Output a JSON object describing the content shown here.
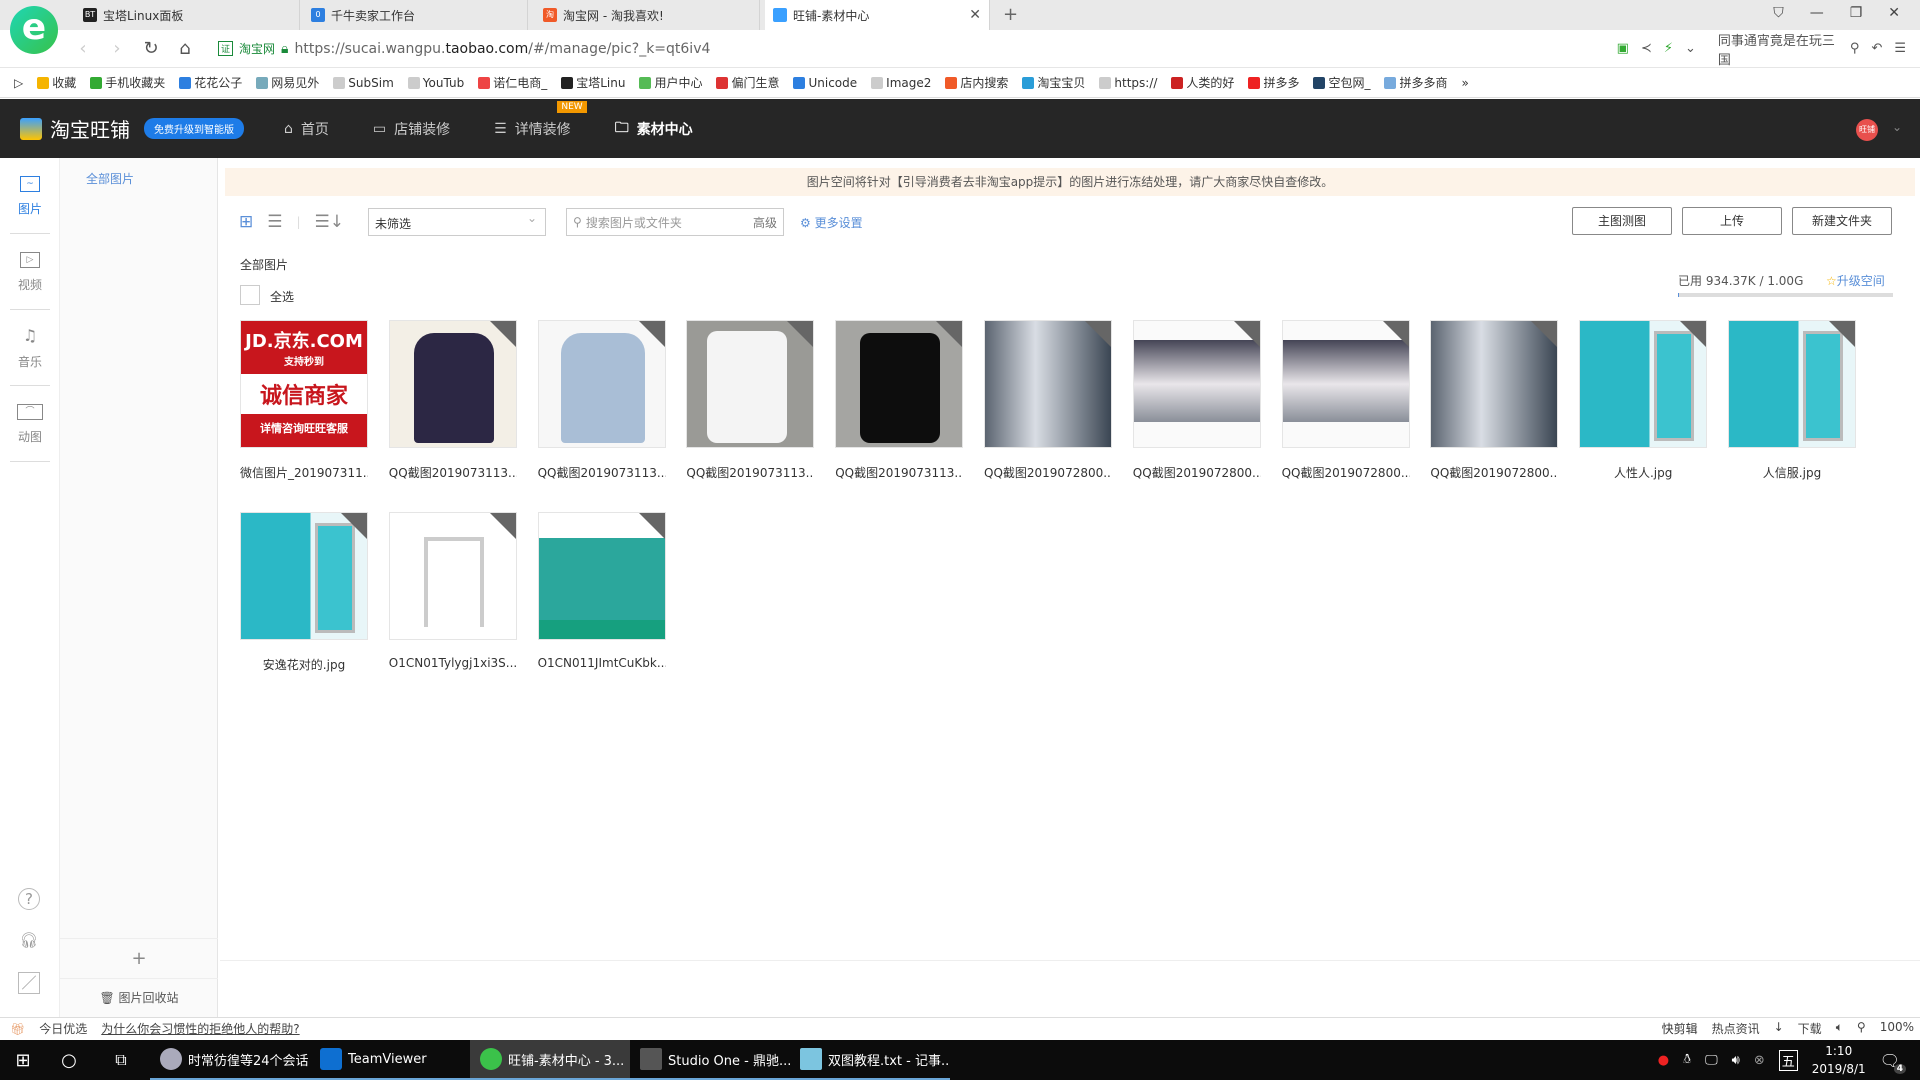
{
  "browser": {
    "tabs": [
      {
        "label": "宝塔Linux面板",
        "icon": "BT"
      },
      {
        "label": "千牛卖家工作台",
        "icon": "qianniu"
      },
      {
        "label": "淘宝网 - 淘我喜欢!",
        "icon": "taobao"
      },
      {
        "label": "旺铺-素材中心",
        "icon": "wangpu",
        "active": true
      }
    ],
    "url_prefix": "https://sucai.wangpu.",
    "url_domain": "taobao.com",
    "url_suffix": "/#/manage/pic?_k=qt6iv4",
    "cert_label": "淘宝网",
    "search_hint": "同事通宵竟是在玩三国",
    "bookmarks": [
      "收藏",
      "手机收藏夹",
      "花花公子",
      "网易见外",
      "SubSim",
      "YouTub",
      "诺仁电商_",
      "宝塔Linu",
      "用户中心",
      "偏门生意",
      "Unicode",
      "Image2",
      "店内搜索",
      "淘宝宝贝",
      "https://",
      "人类的好",
      "拼多多",
      "空包网_",
      "拼多多商"
    ]
  },
  "app": {
    "brand": "淘宝旺铺",
    "upgrade": "免费升级到智能版",
    "nav": [
      {
        "label": "首页"
      },
      {
        "label": "店铺装修"
      },
      {
        "label": "详情装修",
        "badge": "NEW"
      },
      {
        "label": "素材中心",
        "active": true
      }
    ],
    "avatar": "旺铺"
  },
  "rail": [
    {
      "label": "图片",
      "active": true
    },
    {
      "label": "视频"
    },
    {
      "label": "音乐"
    },
    {
      "label": "动图"
    }
  ],
  "folders": {
    "all": "全部图片",
    "add": "+",
    "recycle": "图片回收站"
  },
  "notice": "图片空间将针对【引导消费者去非淘宝app提示】的图片进行冻结处理，请广大商家尽快自查修改。",
  "toolbar": {
    "filter": "未筛选",
    "search_placeholder": "搜索图片或文件夹",
    "advanced": "高级",
    "more": "更多设置",
    "btn_main": "主图测图",
    "btn_upload": "上传",
    "btn_new_folder": "新建文件夹"
  },
  "content": {
    "heading": "全部图片",
    "select_all": "全选",
    "usage": "已用 934.37K / 1.00G",
    "usage_fraction": 0.0009,
    "upgrade": "升级空间"
  },
  "images": [
    {
      "name": "微信图片_201907311...",
      "kind": "jd"
    },
    {
      "name": "QQ截图2019073113...",
      "kind": "navy"
    },
    {
      "name": "QQ截图2019073113...",
      "kind": "blue"
    },
    {
      "name": "QQ截图2019073113...",
      "kind": "white"
    },
    {
      "name": "QQ截图2019073113...",
      "kind": "black"
    },
    {
      "name": "QQ截图2019072800...",
      "kind": "poster"
    },
    {
      "name": "QQ截图2019072800...",
      "kind": "poster2"
    },
    {
      "name": "QQ截图2019072800...",
      "kind": "poster2"
    },
    {
      "name": "QQ截图2019072800...",
      "kind": "poster"
    },
    {
      "name": "人性人.jpg",
      "kind": "teal"
    },
    {
      "name": "人信服.jpg",
      "kind": "teal"
    },
    {
      "name": "安逸花对的.jpg",
      "kind": "teal"
    },
    {
      "name": "O1CN01Tylygj1xi3S...",
      "kind": "frame"
    },
    {
      "name": "O1CN011JImtCuKbk...",
      "kind": "teal2"
    }
  ],
  "jd_lettering": [
    "JD.京东.COM",
    "支持秒到",
    "诚信商家",
    "详情咨询旺旺客服"
  ],
  "statusbar": {
    "left1": "今日优选",
    "left2": "为什么你会习惯性的拒绝他人的帮助?",
    "right": [
      "快剪辑",
      "热点资讯",
      "下载",
      "100%"
    ]
  },
  "taskbar": {
    "items": [
      {
        "label": "时常彷徨等24个会话"
      },
      {
        "label": "TeamViewer"
      },
      {
        "label": "旺铺-素材中心 - 3...",
        "active": true
      },
      {
        "label": "Studio One - 鼎驰..."
      },
      {
        "label": "双图教程.txt - 记事..."
      }
    ],
    "ime": "五",
    "time": "1:10",
    "date": "2019/8/1",
    "notifications": "4"
  }
}
